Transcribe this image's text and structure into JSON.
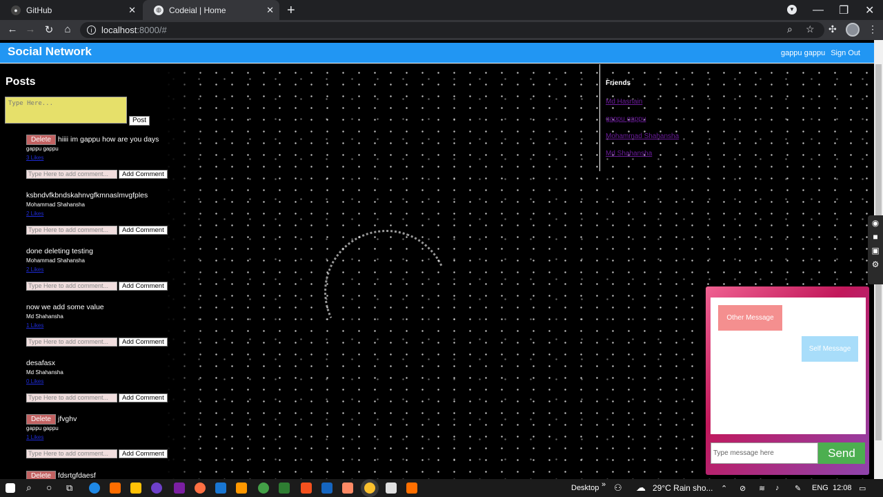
{
  "browser": {
    "tabs": [
      {
        "title": "GitHub",
        "active": false
      },
      {
        "title": "Codeial | Home",
        "active": true
      }
    ],
    "url_host": "localhost",
    "url_path": ":8000/#"
  },
  "navbar": {
    "brand": "Social Network",
    "user": "gappu gappu",
    "signout": "Sign Out"
  },
  "posts_section": {
    "heading": "Posts",
    "input_placeholder": "Type Here...",
    "post_button": "Post",
    "comment_placeholder": "Type Here to add comment...",
    "comment_button": "Add Comment",
    "delete_label": "Delete",
    "items": [
      {
        "content": "hiiii im gappu how are you days",
        "author": "gappu gappu",
        "likes": "3 Likes",
        "deletable": true
      },
      {
        "content": "ksbndvfkbndskahnvgfkmnaslmvgfples",
        "author": "Mohammad Shahansha",
        "likes": "2 Likes",
        "deletable": false
      },
      {
        "content": "done deleting testing",
        "author": "Mohammad Shahansha",
        "likes": "2 Likes",
        "deletable": false
      },
      {
        "content": "now we add some value",
        "author": "Md Shahansha",
        "likes": "1 Likes",
        "deletable": false
      },
      {
        "content": "desafasx",
        "author": "Md Shahansha",
        "likes": "0 Likes",
        "deletable": false
      },
      {
        "content": "jfvghv",
        "author": "gappu gappu",
        "likes": "1 Likes",
        "deletable": true
      },
      {
        "content": "fdsrtgfdaesf",
        "author": "",
        "likes": "",
        "deletable": true
      }
    ]
  },
  "friends": {
    "heading": "Friends",
    "list": [
      "Md Hasnain",
      "gappu gappu",
      "Mohammad Shahansha",
      "Md Shahansha"
    ]
  },
  "chat": {
    "other_message": "Other Message",
    "self_message": "Self Message",
    "input_placeholder": "Type message here",
    "send_label": "Send"
  },
  "taskbar": {
    "desktop_label": "Desktop",
    "weather": "29°C  Rain sho...",
    "language": "ENG",
    "time": "12:08"
  },
  "colors": {
    "navbar": "#2196f3",
    "post_input": "#e6e06a",
    "delete_btn": "#c26262",
    "send_btn": "#4caf50"
  }
}
